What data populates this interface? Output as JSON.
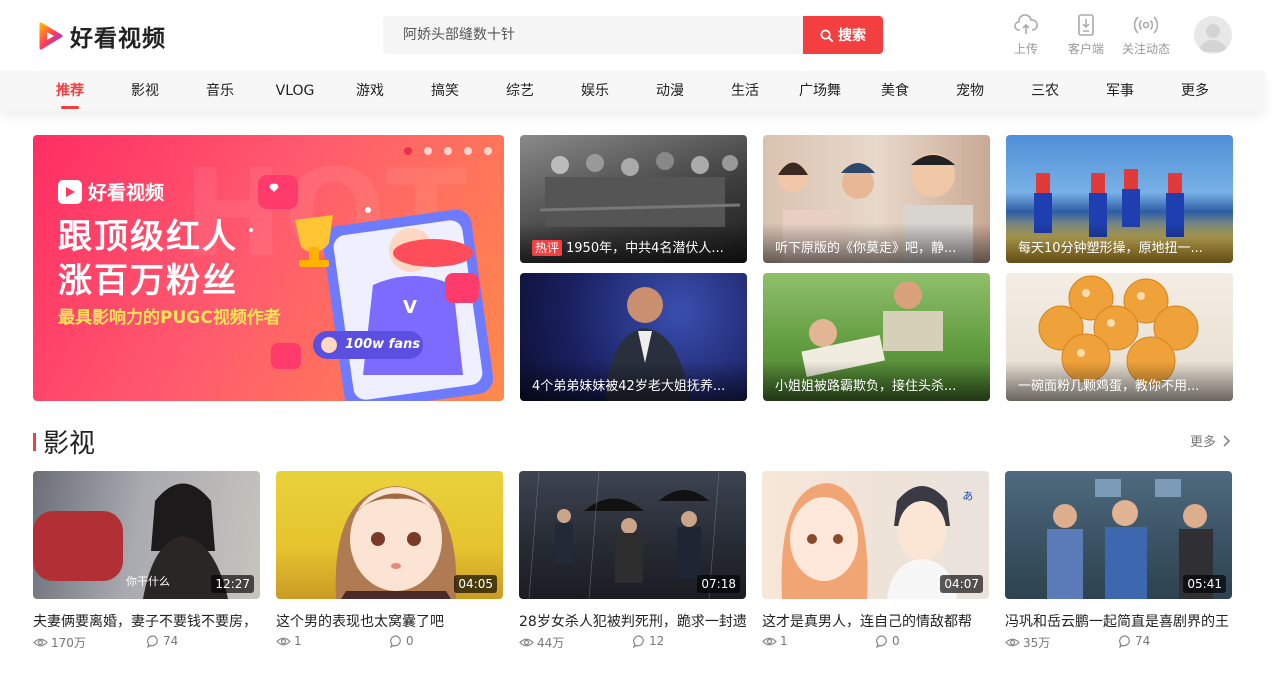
{
  "header": {
    "logo_text": "好看视频",
    "search_placeholder": "阿娇头部缝数十针",
    "search_button": "搜索",
    "tools": [
      {
        "label": "上传",
        "icon": "upload-cloud-icon"
      },
      {
        "label": "客户端",
        "icon": "mobile-client-icon"
      },
      {
        "label": "关注动态",
        "icon": "broadcast-icon"
      }
    ]
  },
  "nav": {
    "items": [
      "推荐",
      "影视",
      "音乐",
      "VLOG",
      "游戏",
      "搞笑",
      "综艺",
      "娱乐",
      "动漫",
      "生活",
      "广场舞",
      "美食",
      "宠物",
      "三农",
      "军事",
      "更多"
    ],
    "active": "推荐"
  },
  "banner": {
    "logo_text": "好看视频",
    "headline_1": "跟顶级红人",
    "headline_2": "涨百万粉丝",
    "subline": "最具影响力的PUGC视频作者",
    "badge_text": "100w fans",
    "slide_count": 5,
    "active_slide": 1
  },
  "featured": [
    {
      "tag": "热评",
      "title": "1950年，中共4名潜伏人..."
    },
    {
      "tag": "",
      "title": "听下原版的《你莫走》吧，静..."
    },
    {
      "tag": "",
      "title": "每天10分钟塑形操，原地扭一..."
    },
    {
      "tag": "",
      "title": "4个弟弟妹妹被42岁老大姐抚养..."
    },
    {
      "tag": "",
      "title": "小姐姐被路霸欺负，接住头杀..."
    },
    {
      "tag": "",
      "title": "一碗面粉几颗鸡蛋，教你不用..."
    }
  ],
  "section": {
    "title": "影视",
    "more": "更多"
  },
  "videos": [
    {
      "title": "夫妻俩要离婚，妻子不要钱不要房，",
      "duration": "12:27",
      "views": "170万",
      "comments": "74",
      "subtitle": "你干什么"
    },
    {
      "title": "这个男的表现也太窝囊了吧",
      "duration": "04:05",
      "views": "1",
      "comments": "0"
    },
    {
      "title": "28岁女杀人犯被判死刑，跪求一封遗",
      "duration": "07:18",
      "views": "44万",
      "comments": "12"
    },
    {
      "title": "这才是真男人，连自己的情敌都帮",
      "duration": "04:07",
      "views": "1",
      "comments": "0"
    },
    {
      "title": "冯巩和岳云鹏一起简直是喜剧界的王",
      "duration": "05:41",
      "views": "35万",
      "comments": "74"
    }
  ],
  "colors": {
    "accent": "#f33f3f"
  }
}
